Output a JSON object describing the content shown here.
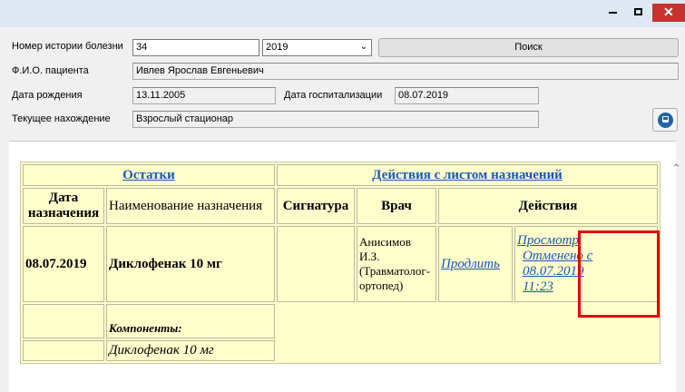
{
  "window": {
    "min_label": "—",
    "max_label": "□",
    "close_label": "✕"
  },
  "form": {
    "case_number_label": "Номер истории болезни",
    "case_number_value": "34",
    "year_selected": "2019",
    "search_button": "Поиск",
    "patient_name_label": "Ф.И.О. пациента",
    "patient_name_value": "Ивлев Ярослав Евгеньевич",
    "birth_date_label": "Дата рождения",
    "birth_date_value": "13.11.2005",
    "admission_date_label": "Дата госпитализации",
    "admission_date_value": "08.07.2019",
    "location_label": "Текущее нахождение",
    "location_value": "Взрослый стационар"
  },
  "table": {
    "tab_remainders": "Остатки",
    "tab_actions": "Действия с листом назначений",
    "col_date": "Дата назначения",
    "col_name": "Наименование назначения",
    "col_signature": "Сигнатура",
    "col_doctor": "Врач",
    "col_actions": "Действия",
    "row": {
      "date": "08.07.2019",
      "name": "Диклофенак 10 мг",
      "doctor": "Анисимов И.З. (Травматолог-ортопед)",
      "extend": "Продлить",
      "view": "Просмотр",
      "cancelled": "Отменено с 08.07.2019 11:23"
    },
    "components_label": "Компоненты:",
    "component_name": "Диклофенак 10 мг"
  }
}
